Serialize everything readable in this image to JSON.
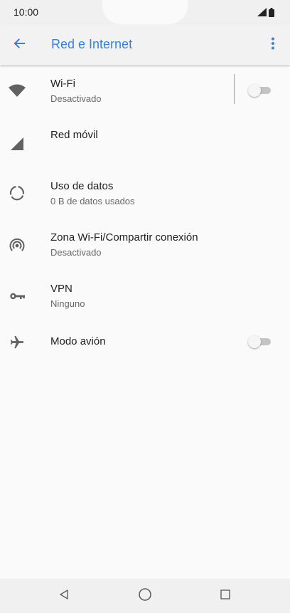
{
  "status_bar": {
    "time": "10:00",
    "icons": [
      "signal-icon",
      "battery-icon"
    ]
  },
  "app_bar": {
    "title": "Red e Internet",
    "back_icon": "arrow-left-icon",
    "menu_icon": "more-vert-icon",
    "accent": "#3d7fd6"
  },
  "settings": {
    "wifi": {
      "label": "Wi-Fi",
      "summary": "Desactivado",
      "toggle_on": false,
      "icon": "wifi-icon"
    },
    "mobile": {
      "label": "Red móvil",
      "icon": "signal-cellular-icon"
    },
    "data": {
      "label": "Uso de datos",
      "summary": "0 B de datos usados",
      "icon": "data-usage-icon"
    },
    "hotspot": {
      "label": "Zona Wi-Fi/Compartir conexión",
      "summary": "Desactivado",
      "icon": "hotspot-icon"
    },
    "vpn": {
      "label": "VPN",
      "summary": "Ninguno",
      "icon": "vpn-key-icon"
    },
    "airplane": {
      "label": "Modo avión",
      "toggle_on": false,
      "icon": "airplane-icon"
    }
  },
  "nav_bar": {
    "icons": [
      "back-triangle-icon",
      "home-circle-icon",
      "recents-square-icon"
    ]
  }
}
